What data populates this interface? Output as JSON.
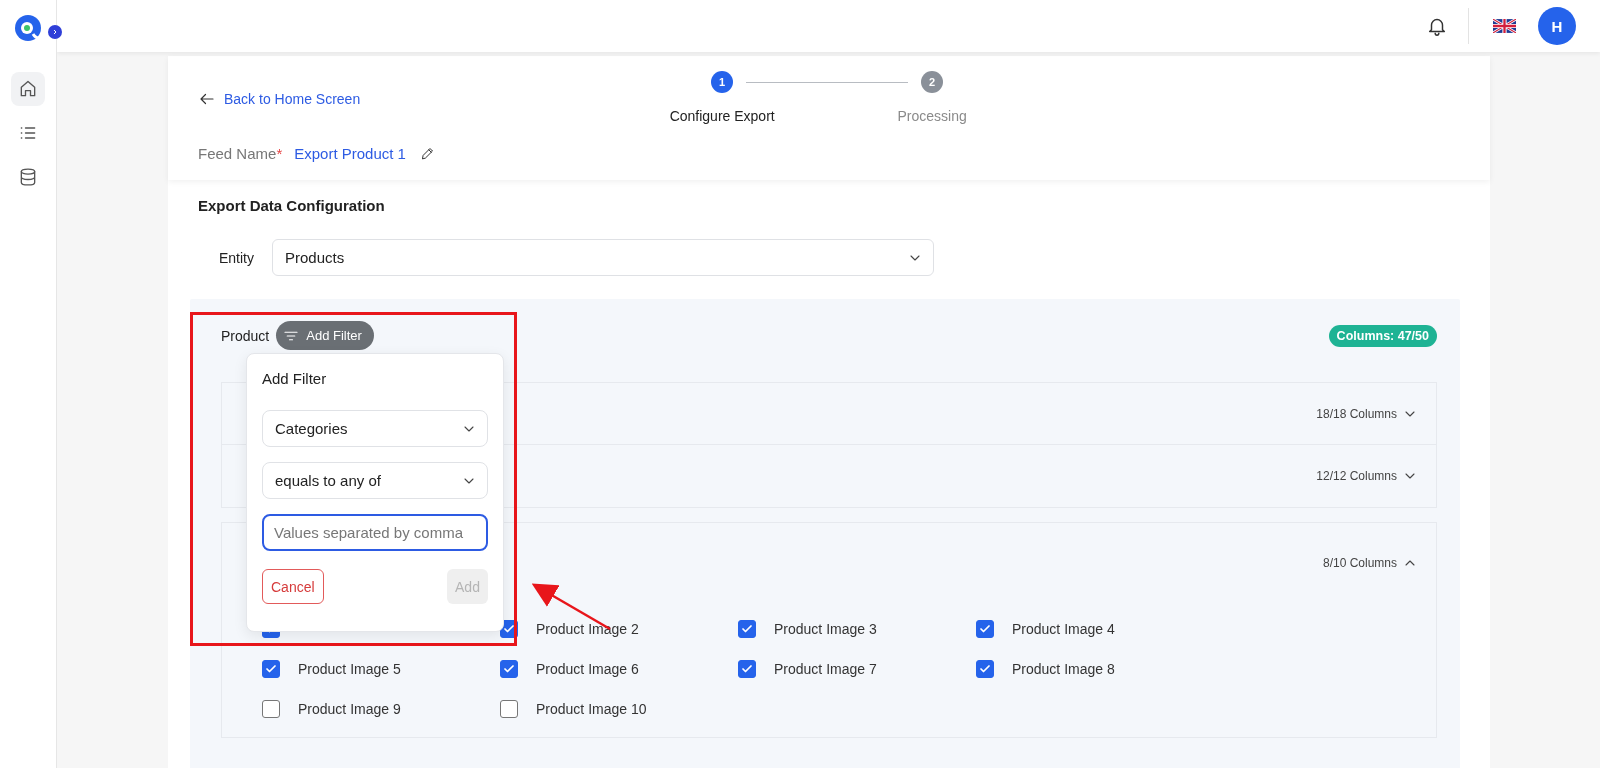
{
  "sidebar": {
    "items": [
      {
        "kind": "home",
        "selected": true
      },
      {
        "kind": "list",
        "selected": false
      },
      {
        "kind": "database",
        "selected": false
      }
    ]
  },
  "topbar": {
    "avatar_initial": "H"
  },
  "header": {
    "back_link": "Back to Home Screen",
    "steps": [
      {
        "number": "1",
        "label": "Configure Export",
        "selected": true
      },
      {
        "number": "2",
        "label": "Processing",
        "selected": false
      }
    ],
    "feed_name_label": "Feed Name",
    "required_mark": "*",
    "feed_name": "Export Product 1"
  },
  "config": {
    "title": "Export Data Configuration",
    "entity_label": "Entity",
    "entity_value": "Products",
    "panel": {
      "label": "Product",
      "add_filter_button": "Add Filter",
      "columns_badge": "Columns: 47/50",
      "groups": [
        {
          "count": "18/18 Columns",
          "expanded": false
        },
        {
          "count": "12/12 Columns",
          "expanded": false
        },
        {
          "count": "8/10 Columns",
          "expanded": true,
          "items": [
            {
              "checked": true
            },
            {
              "label": "Product Image 2",
              "checked": true
            },
            {
              "label": "Product Image 3",
              "checked": true
            },
            {
              "label": "Product Image 4",
              "checked": true
            },
            {
              "label": "Product Image 5",
              "checked": true
            },
            {
              "label": "Product Image 6",
              "checked": true
            },
            {
              "label": "Product Image 7",
              "checked": true
            },
            {
              "label": "Product Image 8",
              "checked": true
            },
            {
              "label": "Product Image 9",
              "checked": false
            },
            {
              "label": "Product Image 10",
              "checked": false
            }
          ]
        }
      ]
    }
  },
  "filter_popup": {
    "title": "Add Filter",
    "field_select": "Categories",
    "operator_select": "equals to any of",
    "values_placeholder": "Values separated by comma",
    "cancel_button": "Cancel",
    "add_button": "Add",
    "add_disabled": true
  }
}
